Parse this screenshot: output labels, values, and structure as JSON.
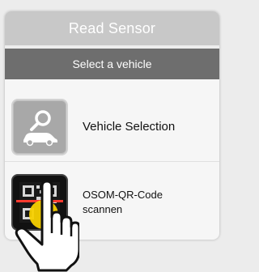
{
  "header": {
    "title": "Read Sensor",
    "subtitle": "Select a vehicle"
  },
  "menu": {
    "items": [
      {
        "label": "Vehicle Selection",
        "icon": "vehicle-search-icon"
      },
      {
        "label_line1": "OSOM-QR-Code",
        "label_line2": "scannen",
        "icon": "qr-code-scan-icon"
      }
    ]
  },
  "colors": {
    "title_bar": "#c8c8c8",
    "subtitle_bar": "#6e6e6e",
    "panel": "#f6f6f6",
    "highlight": "#f7d000"
  }
}
